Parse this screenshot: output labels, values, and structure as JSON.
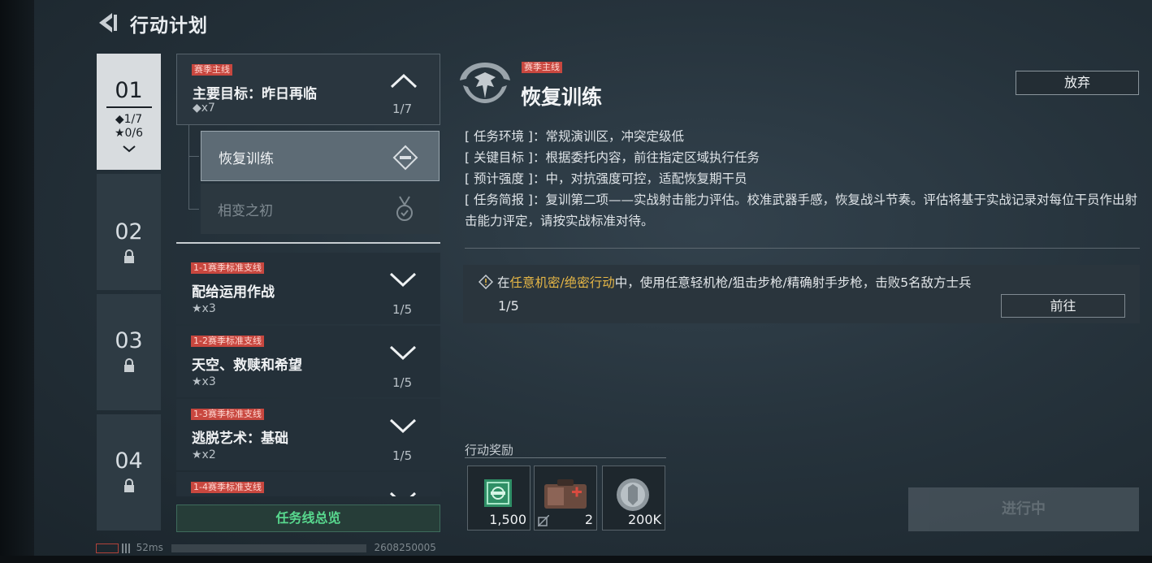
{
  "header": {
    "title": "行动计划"
  },
  "chapters": [
    {
      "num": "01",
      "diamond_progress": "◆1/7",
      "star_progress": "★0/6"
    },
    {
      "num": "02"
    },
    {
      "num": "03"
    },
    {
      "num": "04"
    }
  ],
  "main_mission": {
    "tag": "赛季主线",
    "title": "主要目标：昨日再临",
    "reward": "◆x7",
    "count": "1/7"
  },
  "sub_missions": [
    {
      "label": "恢复训练"
    },
    {
      "label": "相变之初"
    }
  ],
  "side_missions": [
    {
      "tag": "1-1赛季标准支线",
      "title": "配给运用作战",
      "reward": "★x3",
      "count": "1/5"
    },
    {
      "tag": "1-2赛季标准支线",
      "title": "天空、救赎和希望",
      "reward": "★x3",
      "count": "1/5"
    },
    {
      "tag": "1-3赛季标准支线",
      "title": "逃脱艺术：基础",
      "reward": "★x2",
      "count": "1/5"
    },
    {
      "tag": "1-4赛季标准支线"
    }
  ],
  "overview_button": "任务线总览",
  "detail": {
    "tag": "赛季主线",
    "title": "恢复训练",
    "abandon_label": "放弃",
    "info": [
      {
        "key": "[ 任务环境 ]：",
        "value": "常规演训区，冲突定级低"
      },
      {
        "key": "[ 关键目标 ]：",
        "value": "根据委托内容，前往指定区域执行任务"
      },
      {
        "key": "[ 预计强度 ]：",
        "value": "中，对抗强度可控，适配恢复期干员"
      },
      {
        "key": "[ 任务简报 ]：",
        "value": "复训第二项——实战射击能力评估。校准武器手感，恢复战斗节奏。评估将基于实战记录对每位干员作出射击能力评定，请按实战标准对待。"
      }
    ],
    "task": {
      "pre": "在",
      "highlight": "任意机密/绝密行动",
      "post": "中，使用任意轻机枪/狙击步枪/精确射手步枪，击败5名敌方士兵",
      "progress": "1/5",
      "goto_label": "前往"
    },
    "rewards_label": "行动奖励",
    "rewards": [
      {
        "icon": "supply-crate-icon",
        "amount": "1,500"
      },
      {
        "icon": "medkit-icon",
        "amount": "2"
      },
      {
        "icon": "coin-icon",
        "amount": "200K"
      }
    ],
    "status_button": "进行中"
  },
  "footer": {
    "ping": "52ms",
    "uid": "2608250005"
  },
  "colors": {
    "accent_tag": "#c8473f",
    "highlight": "#e5b646",
    "overview_green": "#58d88e"
  }
}
